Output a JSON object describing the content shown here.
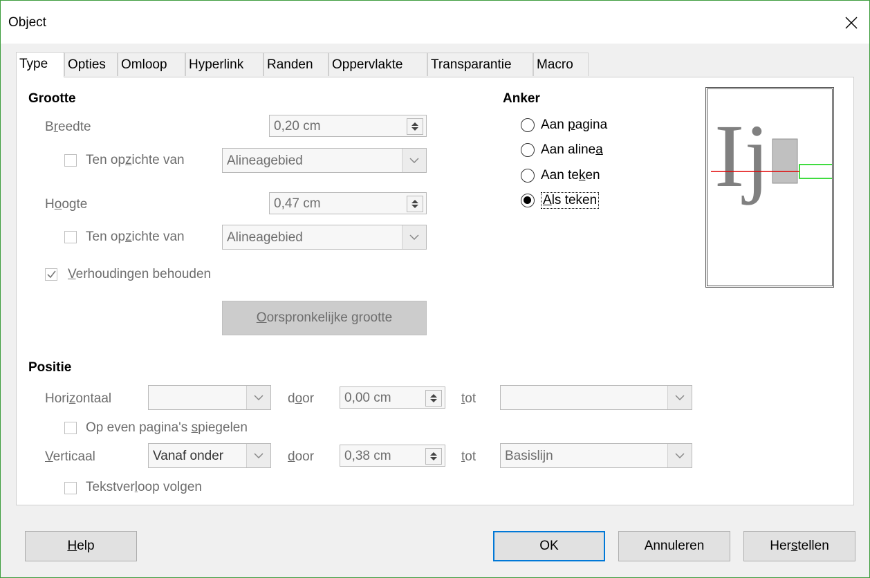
{
  "window": {
    "title": "Object"
  },
  "tabs": [
    "Type",
    "Opties",
    "Omloop",
    "Hyperlink",
    "Randen",
    "Oppervlakte",
    "Transparantie",
    "Macro"
  ],
  "size": {
    "title": "Grootte",
    "width_label": "Breedte",
    "width_value": "0,20 cm",
    "relative_label": "Ten opzichte van",
    "relative_value": "Alineagebied",
    "height_label": "Hoogte",
    "height_value": "0,47 cm",
    "relative2_label": "Ten opzichte van",
    "relative2_value": "Alineagebied",
    "keep_ratio_label": "Verhoudingen behouden",
    "original_size_button": "Oorspronkelijke grootte"
  },
  "anchor": {
    "title": "Anker",
    "options": [
      "Aan pagina",
      "Aan alinea",
      "Aan teken",
      "Als teken"
    ],
    "selected": "Als teken"
  },
  "preview": {
    "glyph": "Ij",
    "highlight_color": "#00d000",
    "baseline_color": "#e00000"
  },
  "position": {
    "title": "Positie",
    "horizontal_label": "Horizontaal",
    "horizontal_value": "",
    "by_label": "door",
    "horizontal_by_value": "0,00 cm",
    "to_label": "tot",
    "horizontal_to_value": "",
    "mirror_label": "Op even pagina's spiegelen",
    "vertical_label": "Verticaal",
    "vertical_value": "Vanaf onder",
    "vertical_by_value": "0,38 cm",
    "vertical_to_value": "Basislijn",
    "follow_label": "Tekstverloop volgen"
  },
  "buttons": {
    "help": "Help",
    "ok": "OK",
    "cancel": "Annuleren",
    "reset": "Herstellen"
  }
}
